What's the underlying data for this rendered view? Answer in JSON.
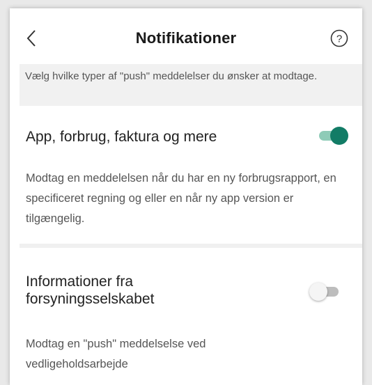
{
  "header": {
    "title": "Notifikationer",
    "back_icon": "chevron-left-icon",
    "help_icon": "question-circle-icon"
  },
  "intro_text": "Vælg hvilke typer af \"push\" meddelelser du ønsker at modtage.",
  "sections": [
    {
      "title": "App, forbrug, faktura og mere",
      "description": "Modtag en meddelelsen når du har en ny forbrugsrapport, en specificeret regning og eller en når ny app version er tilgængelig.",
      "toggle_on": true
    },
    {
      "title": "Informationer fra forsyningsselskabet",
      "description": "Modtag en \"push\" meddelselse ved vedligeholdsarbejde",
      "toggle_on": false
    }
  ],
  "colors": {
    "toggle_on_thumb": "#127c66",
    "toggle_on_track": "#8ecbb7",
    "toggle_off_thumb": "#f5f5f5",
    "toggle_off_track": "#bdbdbd"
  }
}
